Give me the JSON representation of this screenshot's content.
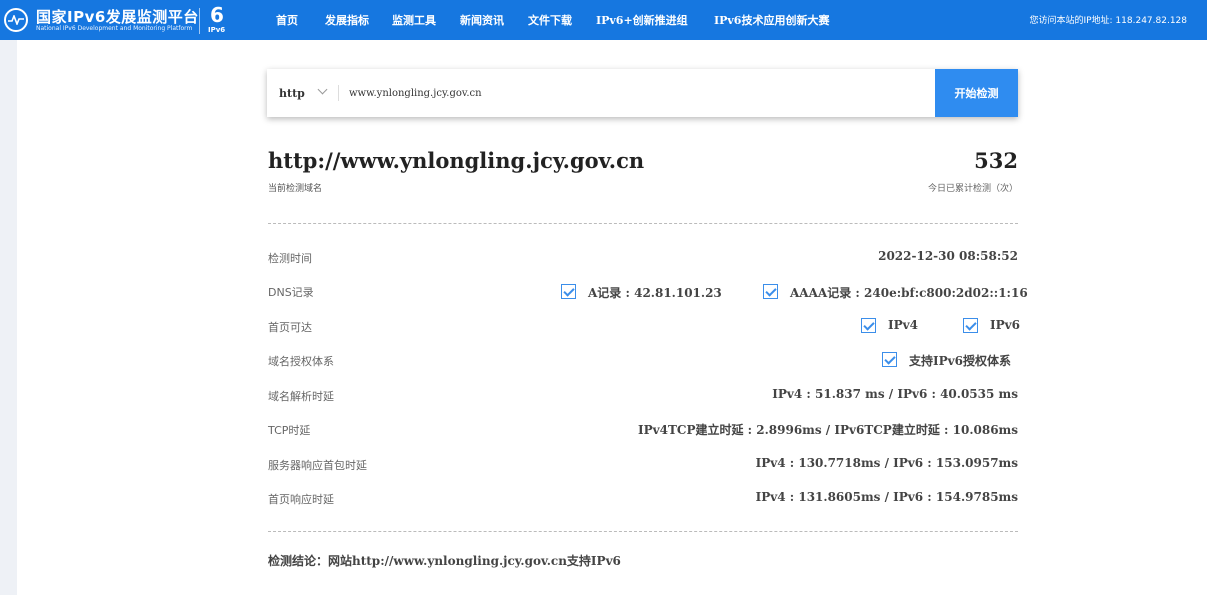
{
  "header": {
    "logo_title": "国家IPv6发展监测平台",
    "logo_subtitle": "National IPv6 Development and Monitoring Platform",
    "ipv6_badge": "IPv6",
    "nav": [
      "首页",
      "发展指标",
      "监测工具",
      "新闻资讯",
      "文件下载",
      "IPv6+创新推进组",
      "IPv6技术应用创新大赛"
    ],
    "ip_info": "您访问本站的IP地址: 118.247.82.128"
  },
  "search": {
    "protocol": "http",
    "url_value": "www.ynlongling.jcy.gov.cn",
    "button_label": "开始检测"
  },
  "summary": {
    "domain": "http://www.ynlongling.jcy.gov.cn",
    "domain_caption": "当前检测域名",
    "count": "532",
    "count_caption": "今日已累计检测（次）"
  },
  "rows": {
    "time_label": "检测时间",
    "time_value": "2022-12-30 08:58:52",
    "dns_label": "DNS记录",
    "dns_a": "A记录 : 42.81.101.23",
    "dns_aaaa": "AAAA记录 : 240e:bf:c800:2d02::1:16",
    "reach_label": "首页可达",
    "reach_ipv4": "IPv4",
    "reach_ipv6": "IPv6",
    "auth_label": "域名授权体系",
    "auth_value": "支持IPv6授权体系",
    "resolve_label": "域名解析时延",
    "resolve_value": "IPv4 : 51.837 ms / IPv6 : 40.0535 ms",
    "tcp_label": "TCP时延",
    "tcp_value": "IPv4TCP建立时延 : 2.8996ms / IPv6TCP建立时延 : 10.086ms",
    "first_packet_label": "服务器响应首包时延",
    "first_packet_value": "IPv4 : 130.7718ms / IPv6 : 153.0957ms",
    "page_resp_label": "首页响应时延",
    "page_resp_value": "IPv4 : 131.8605ms / IPv6 : 154.9785ms"
  },
  "conclusion": "检测结论：网站http://www.ynlongling.jcy.gov.cn支持IPv6",
  "colors": {
    "header_bg": "#1677e0",
    "accent": "#2f8cf0",
    "checkbox": "#3b8eea"
  }
}
